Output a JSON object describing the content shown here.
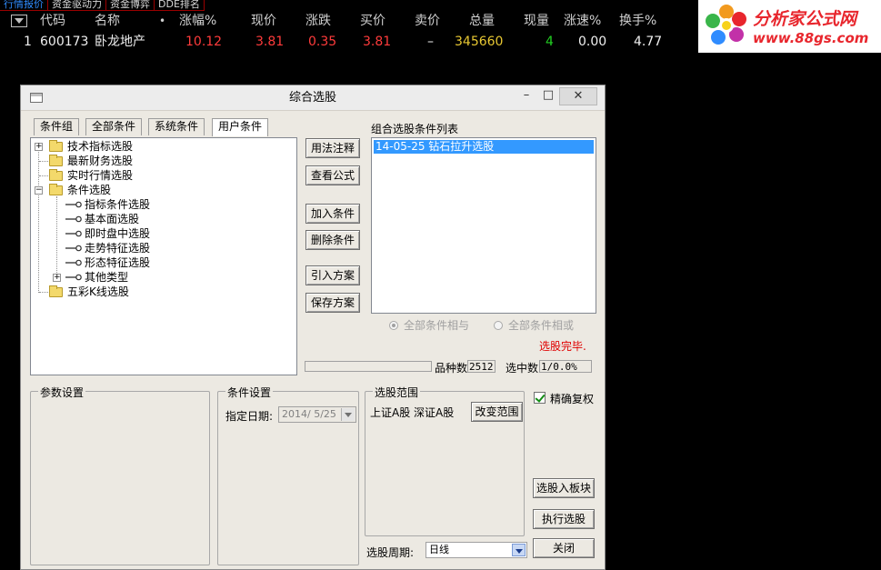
{
  "top_tabs": [
    "行情报价",
    "资金驱动力",
    "资金博弈",
    "DDE排名"
  ],
  "quote_header": [
    "代码",
    "名称",
    "•",
    "涨幅%",
    "现价",
    "涨跌",
    "买价",
    "卖价",
    "总量",
    "现量",
    "涨速%",
    "换手%"
  ],
  "quote_row": {
    "index": "1",
    "code": "600173",
    "name": "卧龙地产",
    "change_pct": "10.12",
    "price": "3.81",
    "change": "0.35",
    "bid": "3.81",
    "ask": "–",
    "volume": "345660",
    "cur_vol": "4",
    "speed": "0.00",
    "turnover": "4.77"
  },
  "logo": {
    "title": "分析家公式网",
    "url": "www.88gs.com"
  },
  "colors": {
    "red": "#ff3b3b",
    "yellow": "#e8c832",
    "green": "#22d022",
    "white": "#f0f0f0",
    "accent": "#3399ff"
  },
  "dialog": {
    "title": "综合选股",
    "window_buttons": {
      "min": "–",
      "max": "□",
      "close": "✕"
    },
    "tabs": [
      "条件组",
      "全部条件",
      "系统条件",
      "用户条件"
    ],
    "tree": {
      "items": [
        "技术指标选股",
        "最新财务选股",
        "实时行情选股",
        "条件选股",
        "五彩K线选股"
      ],
      "children": [
        "指标条件选股",
        "基本面选股",
        "即时盘中选股",
        "走势特征选股",
        "形态特征选股",
        "其他类型"
      ]
    },
    "buttons": {
      "usage": "用法注释",
      "view_formula": "查看公式",
      "add_condition": "加入条件",
      "delete_condition": "删除条件",
      "import_plan": "引入方案",
      "save_plan": "保存方案",
      "change_range": "改变范围",
      "select_to_block": "选股入板块",
      "execute": "执行选股",
      "close": "关闭"
    },
    "list_label": "组合选股条件列表",
    "list_items": [
      "14-05-25 钻石拉升选股"
    ],
    "radio_and": "全部条件相与",
    "radio_or": "全部条件相或",
    "status": "选股完毕.",
    "count_label": "品种数",
    "count_value": "2512",
    "selected_label": "选中数",
    "selected_value": "1/0.0%",
    "param_group": "参数设置",
    "cond_group": "条件设置",
    "date_label": "指定日期:",
    "date_value": "2014/ 5/25",
    "range_group": "选股范围",
    "range_value": "上证A股 深证A股",
    "exact_fq": "精确复权",
    "period_label": "选股周期:",
    "period_value": "日线"
  }
}
